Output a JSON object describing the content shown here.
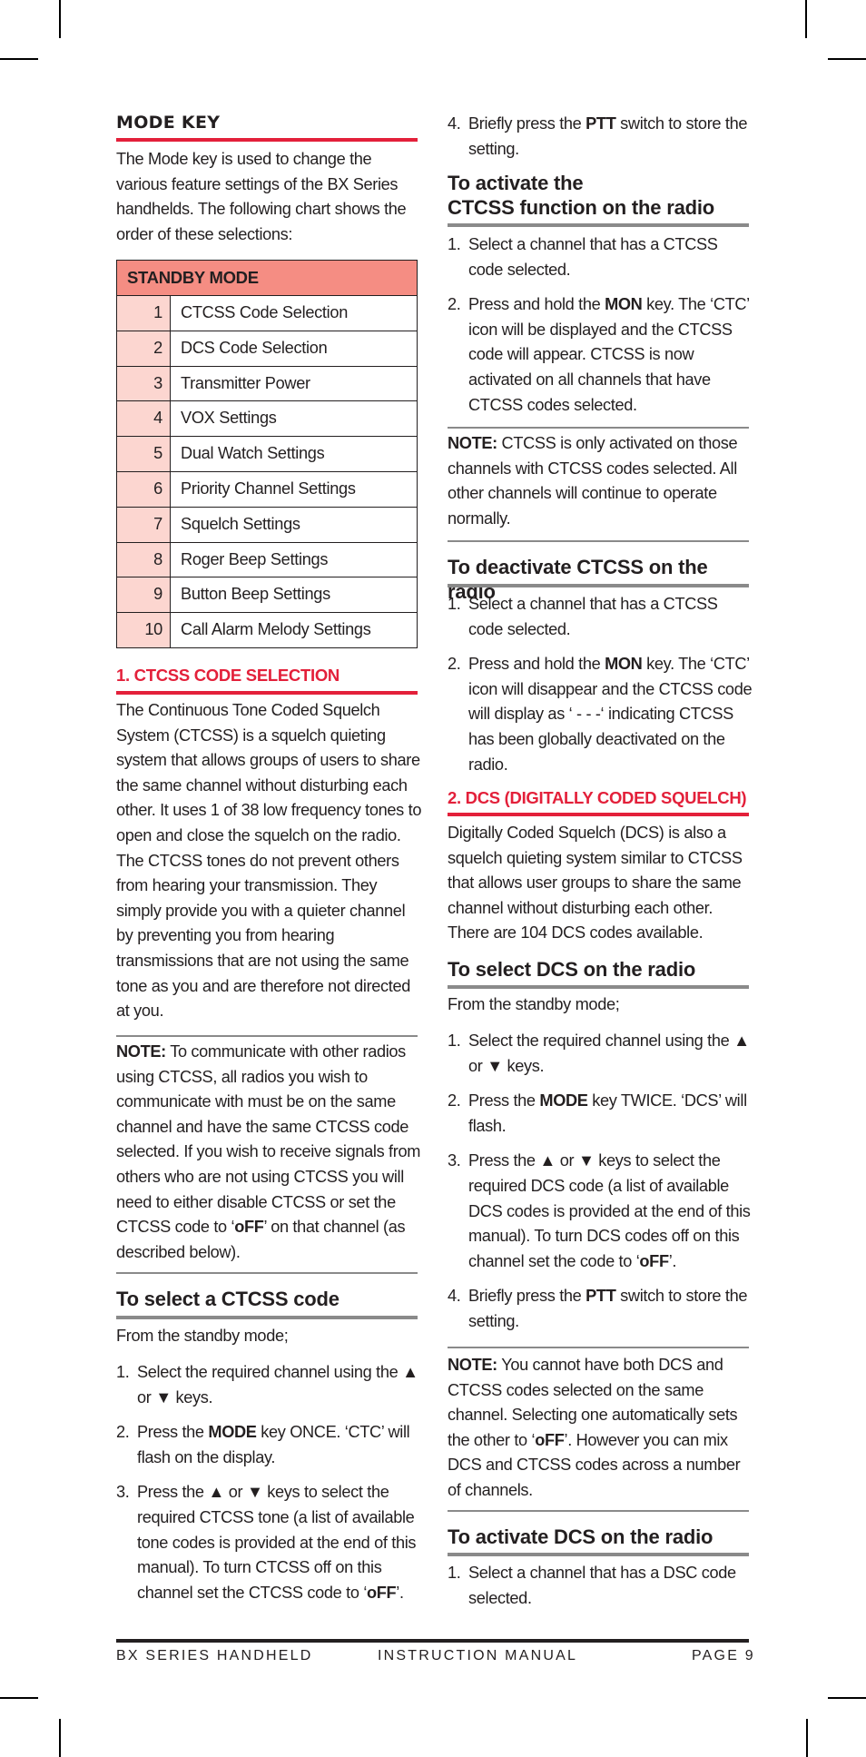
{
  "left": {
    "title": "MODE KEY",
    "intro": "The Mode key is used to change the various feature settings of the BX Series handhelds.  The following chart shows the order of these selections:",
    "table": {
      "header": "STANDBY MODE",
      "rows": [
        {
          "num": "1",
          "label": "CTCSS Code Selection"
        },
        {
          "num": "2",
          "label": "DCS Code Selection"
        },
        {
          "num": "3",
          "label": "Transmitter Power"
        },
        {
          "num": "4",
          "label": "VOX Settings"
        },
        {
          "num": "5",
          "label": "Dual Watch Settings"
        },
        {
          "num": "6",
          "label": "Priority Channel Settings"
        },
        {
          "num": "7",
          "label": "Squelch Settings"
        },
        {
          "num": "8",
          "label": "Roger Beep Settings"
        },
        {
          "num": "9",
          "label": "Button Beep Settings"
        },
        {
          "num": "10",
          "label": "Call Alarm Melody Settings"
        }
      ]
    },
    "ctcss_heading": "1. CTCSS CODE SELECTION",
    "ctcss_body": "The Continuous Tone Coded Squelch System (CTCSS) is a squelch quieting system that allows groups of users to share the same channel without disturbing each other. It uses 1 of 38 low frequency tones to open and close the squelch on the radio. The CTCSS tones do not prevent others from hearing your transmission. They simply provide you with a quieter channel by preventing you from hearing transmissions that are not using the same tone as you and are therefore not directed at you.",
    "note_label": "NOTE:",
    "note_text": " To communicate with other radios using CTCSS, all radios you wish to communicate with must be on the same channel and have the same CTCSS code selected. If you wish to receive signals from others who are not using CTCSS you will need to either disable CTCSS or set the CTCSS code to ‘",
    "note_off": "oFF",
    "note_tail": "’ on that channel (as described below).",
    "select_heading": "To select a CTCSS code",
    "select_intro": "From the standby mode;",
    "steps": [
      {
        "num": "1.",
        "pre": "Select the required channel using the ",
        "up": "▲",
        "mid": " or ",
        "down": "▼",
        "post": " keys."
      },
      {
        "num": "2.",
        "pre": "Press the ",
        "bold": "MODE",
        "post": " key ONCE. ‘CTC’ will flash on the display."
      },
      {
        "num": "3.",
        "pre": "Press the ",
        "up": "▲",
        "mid": " or ",
        "down": "▼",
        "post": " keys to select the required CTCSS tone (a list of available tone codes is provided at the end of this manual). To turn CTCSS off on this channel set the CTCSS code to ‘",
        "off": "oFF",
        "tail": "’."
      }
    ]
  },
  "right": {
    "step4": {
      "num": "4.",
      "pre": "Briefly press the ",
      "bold": "PTT",
      "post": " switch to store the setting."
    },
    "activate_heading_1": "To activate the",
    "activate_heading_2": "CTCSS function on the radio",
    "activate_steps": [
      {
        "num": "1.",
        "text": "Select a channel that has a CTCSS code selected."
      },
      {
        "num": "2.",
        "pre": "Press and hold the ",
        "bold": "MON",
        "post": " key. The ‘CTC’ icon will be displayed and the CTCSS code will appear. CTCSS is now activated on all channels that have CTCSS codes selected."
      }
    ],
    "note1_label": "NOTE:",
    "note1_text": " CTCSS is only activated on those channels with CTCSS codes selected. All other channels will continue to operate normally.",
    "deactivate_heading": "To deactivate CTCSS on the radio",
    "deactivate_steps": [
      {
        "num": "1.",
        "text": "Select a channel that has a CTCSS code selected."
      },
      {
        "num": "2.",
        "pre": "Press and hold the ",
        "bold": "MON",
        "post": " key. The ‘CTC’ icon will disappear and the CTCSS code will display as ‘ - - -‘ indicating CTCSS has been globally deactivated on the radio."
      }
    ],
    "dcs_heading": "2. DCS (DIGITALLY CODED SQUELCH)",
    "dcs_body": "Digitally Coded Squelch (DCS) is also a squelch quieting system similar to CTCSS that allows user groups to share the same channel without disturbing each other. There are 104 DCS codes available.",
    "dcs_select_heading": "To select DCS on the radio",
    "dcs_select_intro": "From the standby mode;",
    "dcs_steps": [
      {
        "num": "1.",
        "pre": "Select the required channel using the ",
        "up": "▲",
        "mid": " or ",
        "down": "▼",
        "post": " keys."
      },
      {
        "num": "2.",
        "pre": "Press the ",
        "bold": "MODE",
        "post": " key TWICE. ‘DCS’ will flash."
      },
      {
        "num": "3.",
        "pre": "Press the ",
        "up": "▲",
        "mid": " or ",
        "down": "▼",
        "post": " keys to select the required DCS code (a list of available DCS codes is provided at the end of this manual). To turn DCS codes off on this channel set the code to ‘",
        "off": "oFF",
        "tail": "’."
      },
      {
        "num": "4.",
        "pre": "Briefly press the ",
        "bold": "PTT",
        "post": " switch to store the setting."
      }
    ],
    "note2_label": "NOTE:",
    "note2_text": " You cannot have both DCS and CTCSS codes selected on the same channel. Selecting one automatically sets the other to ‘",
    "note2_off": "oFF",
    "note2_tail": "’. However you can mix DCS and CTCSS codes across a number of channels.",
    "dcs_activate_heading": "To activate DCS on the radio",
    "dcs_activate_steps": [
      {
        "num": "1.",
        "text": "Select a channel that has a DSC code selected."
      }
    ]
  },
  "footer": {
    "left": "BX SERIES HANDHELD",
    "center": "INSTRUCTION MANUAL",
    "right": "PAGE 9"
  }
}
